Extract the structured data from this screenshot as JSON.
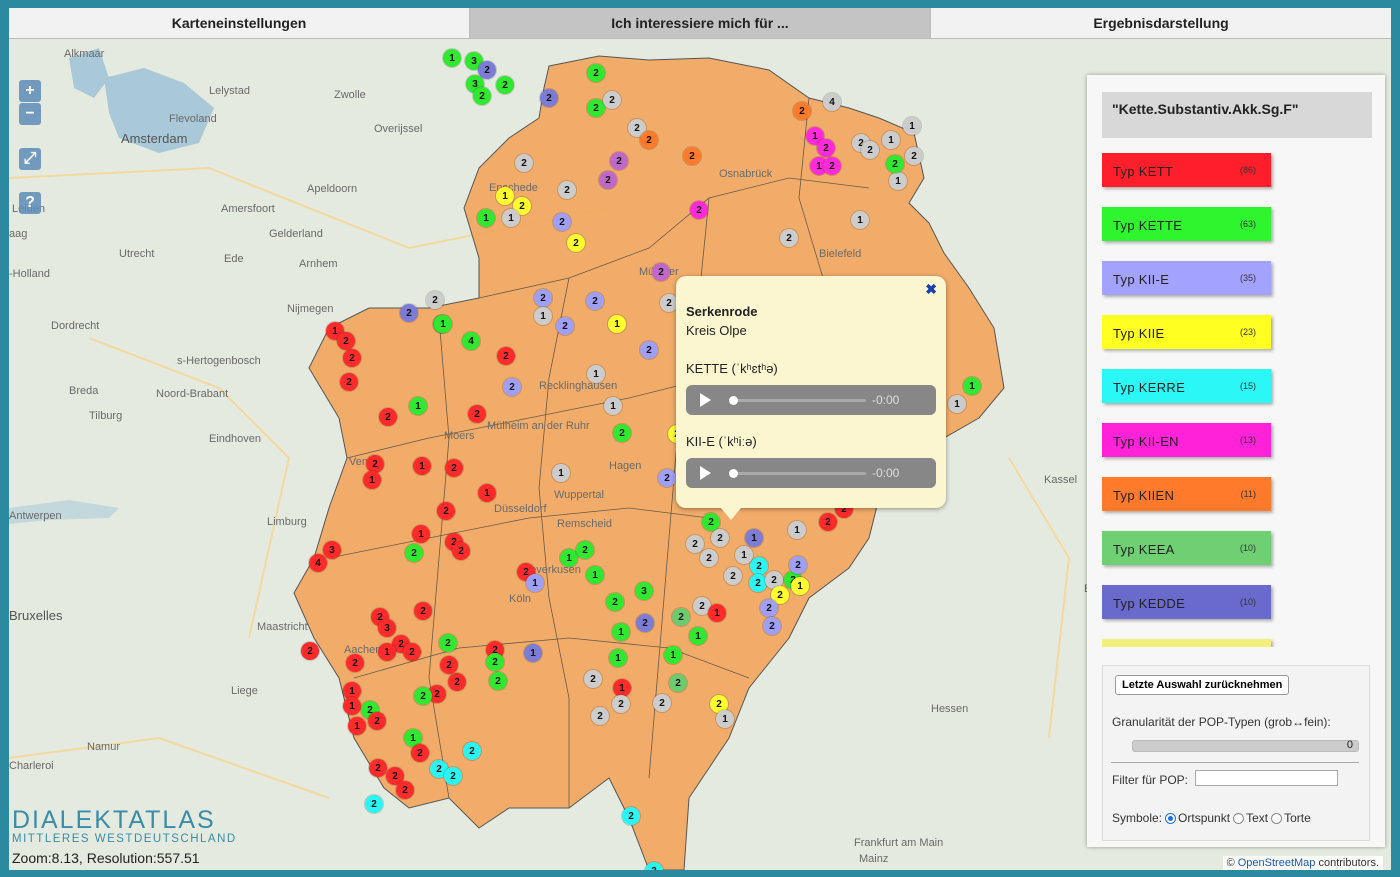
{
  "tabs": [
    {
      "label": "Karteneinstellungen",
      "active": false
    },
    {
      "label": "Ich interessiere mich für ...",
      "active": true
    },
    {
      "label": "Ergebnisdarstellung",
      "active": false
    }
  ],
  "map_controls": {
    "zoom_in": "+",
    "zoom_out": "−",
    "fullscreen": "⤢",
    "help": "?"
  },
  "places": [
    "Alkmaar",
    "Lelystad",
    "Zwolle",
    "Amsterdam",
    "Flevoland",
    "Overijssel",
    "Apeldoorn",
    "Amersfoort",
    "Gelderland",
    "Utrecht",
    "Ede",
    "Arnhem",
    "Leiden",
    "Nijmegen",
    "Dordrecht",
    "s-Hertogenbosch",
    "Breda",
    "Noord-Brabant",
    "Tilburg",
    "Eindhoven",
    "Venlo",
    "Limburg",
    "Maastricht",
    "Liege",
    "Namur",
    "Charleroi",
    "Antwerpen",
    "Bruxelles",
    "Enschede",
    "Osnabrück",
    "Bielefeld",
    "Münster",
    "Recklinghausen",
    "Moers",
    "Mülheim an der Ruhr",
    "Hagen",
    "Düsseldorf",
    "Wuppertal",
    "Remscheid",
    "Leverkusen",
    "Köln",
    "Aachen",
    "Kassel",
    "Hessen",
    "Erbach",
    "Frankfurt am Main",
    "Mainz",
    "-Holland",
    "aag"
  ],
  "markers": [
    {
      "c": "#2fe82f",
      "t": "1"
    },
    {
      "c": "#2fe82f",
      "t": "3"
    },
    {
      "c": "#7c7cd6",
      "t": "2"
    },
    {
      "c": "#2fe82f",
      "t": "3"
    },
    {
      "c": "#2fe82f",
      "t": "2"
    },
    {
      "c": "#2fe82f",
      "t": "2"
    },
    {
      "c": "#2fe82f",
      "t": "2"
    },
    {
      "c": "#2fe82f",
      "t": "2"
    },
    {
      "c": "#cccccc",
      "t": "2"
    },
    {
      "c": "#7c7cd6",
      "t": "2"
    },
    {
      "c": "#cccccc",
      "t": "2"
    },
    {
      "c": "#ff7a2a",
      "t": "2"
    },
    {
      "c": "#cccccc",
      "t": "2"
    },
    {
      "c": "#c068c8",
      "t": "2"
    },
    {
      "c": "#ff7a2a",
      "t": "2"
    },
    {
      "c": "#cccccc",
      "t": "2"
    },
    {
      "c": "#c068c8",
      "t": "2"
    },
    {
      "c": "#ffff30",
      "t": "1"
    },
    {
      "c": "#ffff30",
      "t": "2"
    },
    {
      "c": "#2fe82f",
      "t": "1"
    },
    {
      "c": "#cccccc",
      "t": "1"
    },
    {
      "c": "#9f9ff5",
      "t": "2"
    },
    {
      "c": "#ffff30",
      "t": "2"
    },
    {
      "c": "#ff2ad8",
      "t": "2"
    },
    {
      "c": "#ff7a2a",
      "t": "2"
    },
    {
      "c": "#ff2ad8",
      "t": "1"
    },
    {
      "c": "#ff2ad8",
      "t": "2"
    },
    {
      "c": "#ff2ad8",
      "t": "1"
    },
    {
      "c": "#ff2ad8",
      "t": "2"
    },
    {
      "c": "#cccccc",
      "t": "2"
    },
    {
      "c": "#cccccc",
      "t": "1"
    },
    {
      "c": "#cccccc",
      "t": "4"
    },
    {
      "c": "#cccccc",
      "t": "1"
    },
    {
      "c": "#cccccc",
      "t": "2"
    },
    {
      "c": "#cccccc",
      "t": "2"
    },
    {
      "c": "#cccccc",
      "t": "1"
    },
    {
      "c": "#2fe82f",
      "t": "2"
    },
    {
      "c": "#cccccc",
      "t": "1"
    },
    {
      "c": "#cccccc",
      "t": "2"
    },
    {
      "c": "#c068c8",
      "t": "2"
    },
    {
      "c": "#9f9ff5",
      "t": "2"
    },
    {
      "c": "#cccccc",
      "t": "2"
    },
    {
      "c": "#cccccc",
      "t": "1"
    },
    {
      "c": "#9f9ff5",
      "t": "2"
    },
    {
      "c": "#ffff30",
      "t": "1"
    },
    {
      "c": "#9f9ff5",
      "t": "2"
    },
    {
      "c": "#2fe82f",
      "t": "2"
    },
    {
      "c": "#9f9ff5",
      "t": "2"
    },
    {
      "c": "#cccccc",
      "t": "2"
    },
    {
      "c": "#7c7cd6",
      "t": "2"
    },
    {
      "c": "#ff2a2a",
      "t": "2"
    },
    {
      "c": "#2fe82f",
      "t": "1"
    },
    {
      "c": "#2fe82f",
      "t": "4"
    },
    {
      "c": "#ff2a2a",
      "t": "2"
    },
    {
      "c": "#ff2a2a",
      "t": "1"
    },
    {
      "c": "#ff2a2a",
      "t": "2"
    },
    {
      "c": "#ff2a2a",
      "t": "2"
    },
    {
      "c": "#ff2a2a",
      "t": "2"
    },
    {
      "c": "#2fe82f",
      "t": "1"
    },
    {
      "c": "#ff2a2a",
      "t": "2"
    },
    {
      "c": "#ff2a2a",
      "t": "2"
    },
    {
      "c": "#ff2a2a",
      "t": "1"
    },
    {
      "c": "#ff2a2a",
      "t": "2"
    },
    {
      "c": "#ff2a2a",
      "t": "1"
    },
    {
      "c": "#ff2a2a",
      "t": "1"
    },
    {
      "c": "#ff2a2a",
      "t": "2"
    },
    {
      "c": "#ff2a2a",
      "t": "1"
    },
    {
      "c": "#ff2a2a",
      "t": "2"
    },
    {
      "c": "#2fe82f",
      "t": "2"
    },
    {
      "c": "#ff2a2a",
      "t": "2"
    },
    {
      "c": "#ff2a2a",
      "t": "3"
    },
    {
      "c": "#ff2a2a",
      "t": "4"
    },
    {
      "c": "#ff2a2a",
      "t": "2"
    },
    {
      "c": "#9f9ff5",
      "t": "1"
    },
    {
      "c": "#9f9ff5",
      "t": "2"
    },
    {
      "c": "#cccccc",
      "t": "1"
    },
    {
      "c": "#cccccc",
      "t": "1"
    },
    {
      "c": "#2fe82f",
      "t": "2"
    },
    {
      "c": "#cccccc",
      "t": "1"
    },
    {
      "c": "#2fe82f",
      "t": "1"
    },
    {
      "c": "#2fe82f",
      "t": "2"
    },
    {
      "c": "#2fe82f",
      "t": "1"
    },
    {
      "c": "#2fe82f",
      "t": "3"
    },
    {
      "c": "#2fe82f",
      "t": "2"
    },
    {
      "c": "#7c7cd6",
      "t": "2"
    },
    {
      "c": "#6ccb6c",
      "t": "2"
    },
    {
      "c": "#cccccc",
      "t": "2"
    },
    {
      "c": "#2fe82f",
      "t": "1"
    },
    {
      "c": "#2fe82f",
      "t": "1"
    },
    {
      "c": "#2fe82f",
      "t": "1"
    },
    {
      "c": "#2fe82f",
      "t": "1"
    },
    {
      "c": "#cccccc",
      "t": "2"
    },
    {
      "c": "#ff2a2a",
      "t": "1"
    },
    {
      "c": "#cccccc",
      "t": "2"
    },
    {
      "c": "#cccccc",
      "t": "2"
    },
    {
      "c": "#6ccb6c",
      "t": "2"
    },
    {
      "c": "#cccccc",
      "t": "2"
    },
    {
      "c": "#ffff30",
      "t": "2"
    },
    {
      "c": "#cccccc",
      "t": "1"
    },
    {
      "c": "#ff2a2a",
      "t": "2"
    },
    {
      "c": "#ff2a2a",
      "t": "3"
    },
    {
      "c": "#ff2a2a",
      "t": "2"
    },
    {
      "c": "#ff2a2a",
      "t": "2"
    },
    {
      "c": "#ff2a2a",
      "t": "2"
    },
    {
      "c": "#ff2a2a",
      "t": "2"
    },
    {
      "c": "#ff2a2a",
      "t": "1"
    },
    {
      "c": "#ff2a2a",
      "t": "2"
    },
    {
      "c": "#ff2a2a",
      "t": "2"
    },
    {
      "c": "#ff2a2a",
      "t": "2"
    },
    {
      "c": "#7c7cd6",
      "t": "1"
    },
    {
      "c": "#2fe82f",
      "t": "2"
    },
    {
      "c": "#ff2a2a",
      "t": "1"
    },
    {
      "c": "#ff2a2a",
      "t": "1"
    },
    {
      "c": "#2fe82f",
      "t": "2"
    },
    {
      "c": "#ff2a2a",
      "t": "2"
    },
    {
      "c": "#ff2a2a",
      "t": "1"
    },
    {
      "c": "#ff2a2a",
      "t": "2"
    },
    {
      "c": "#2fe82f",
      "t": "2"
    },
    {
      "c": "#ff2a2a",
      "t": "2"
    },
    {
      "c": "#2fe82f",
      "t": "2"
    },
    {
      "c": "#2fe82f",
      "t": "2"
    },
    {
      "c": "#2fe82f",
      "t": "1"
    },
    {
      "c": "#ff2a2a",
      "t": "2"
    },
    {
      "c": "#ff2a2a",
      "t": "2"
    },
    {
      "c": "#ff2a2a",
      "t": "2"
    },
    {
      "c": "#ff2a2a",
      "t": "2"
    },
    {
      "c": "#2af5f5",
      "t": "2"
    },
    {
      "c": "#2af5f5",
      "t": "2"
    },
    {
      "c": "#2af5f5",
      "t": "2"
    },
    {
      "c": "#2af5f5",
      "t": "2"
    },
    {
      "c": "#2af5f5",
      "t": "2"
    },
    {
      "c": "#2af5f5",
      "t": "3"
    },
    {
      "c": "#2af5f5",
      "t": "2"
    },
    {
      "c": "#2af5f5",
      "t": "2"
    },
    {
      "c": "#cccccc",
      "t": "2"
    },
    {
      "c": "#2fe82f",
      "t": "2"
    },
    {
      "c": "#ffff30",
      "t": "2"
    },
    {
      "c": "#ffff30",
      "t": "1"
    },
    {
      "c": "#9f9ff5",
      "t": "2"
    },
    {
      "c": "#9f9ff5",
      "t": "2"
    },
    {
      "c": "#ffff30",
      "t": "2"
    },
    {
      "c": "#9f9ff5",
      "t": "2"
    },
    {
      "c": "#2fe82f",
      "t": "2"
    },
    {
      "c": "#cccccc",
      "t": "2"
    },
    {
      "c": "#cccccc",
      "t": "2"
    },
    {
      "c": "#cccccc",
      "t": "2"
    },
    {
      "c": "#cccccc",
      "t": "1"
    },
    {
      "c": "#cccccc",
      "t": "2"
    },
    {
      "c": "#cccccc",
      "t": "1"
    },
    {
      "c": "#7c7cd6",
      "t": "1"
    },
    {
      "c": "#ff2a2a",
      "t": "2"
    },
    {
      "c": "#ff2a2a",
      "t": "2"
    },
    {
      "c": "#9f9ff5",
      "t": "2"
    },
    {
      "c": "#ff2a2a",
      "t": "1"
    },
    {
      "c": "#2fe82f",
      "t": "1"
    },
    {
      "c": "#cccccc",
      "t": "1"
    }
  ],
  "popup": {
    "close": "✖",
    "title": "Serkenrode",
    "subtitle": "Kreis Olpe",
    "audio": [
      {
        "label": "KETTE (ˈkʰɛtʰə)",
        "time": "-0:00"
      },
      {
        "label": "KII-E (ˈkʰiːə)",
        "time": "-0:00"
      }
    ]
  },
  "logo": {
    "line1": "DIALEKTATLAS",
    "line2": "MITTLERES WESTDEUTSCHLAND"
  },
  "zoom_status": "Zoom:8.13, Resolution:557.51",
  "panel": {
    "variable": "\"Kette.Substantiv.Akk.Sg.F\"",
    "legend": [
      {
        "name": "Typ KETT",
        "count": "(86)",
        "color": "#ff1f2a"
      },
      {
        "name": "Typ KETTE",
        "count": "(63)",
        "color": "#2ef52e"
      },
      {
        "name": "Typ KII-E",
        "count": "(35)",
        "color": "#a3a3ff"
      },
      {
        "name": "Typ KIIE",
        "count": "(23)",
        "color": "#ffff22"
      },
      {
        "name": "Typ KERRE",
        "count": "(15)",
        "color": "#2cf7f7"
      },
      {
        "name": "Typ KII-EN",
        "count": "(13)",
        "color": "#ff22d8"
      },
      {
        "name": "Typ KIIEN",
        "count": "(11)",
        "color": "#ff7a2a"
      },
      {
        "name": "Typ KEEA",
        "count": "(10)",
        "color": "#6fcf73"
      },
      {
        "name": "Typ KEDDE",
        "count": "(10)",
        "color": "#6a6acc"
      },
      {
        "name": "",
        "count": "",
        "color": "#f3f07a"
      }
    ],
    "undo_label": "Letzte Auswahl zurücknehmen",
    "granularity_label": "Granularität der POP-Typen (grob↔fein):",
    "granularity_value": "0",
    "filter_label": "Filter für POP:",
    "filter_value": "",
    "symbols_label": "Symbole:",
    "symbol_options": [
      "Ortspunkt",
      "Text",
      "Torte"
    ],
    "symbol_selected": "Ortspunkt"
  },
  "attribution": {
    "prefix": "©",
    "link": "OpenStreetMap",
    "suffix": "contributors."
  }
}
